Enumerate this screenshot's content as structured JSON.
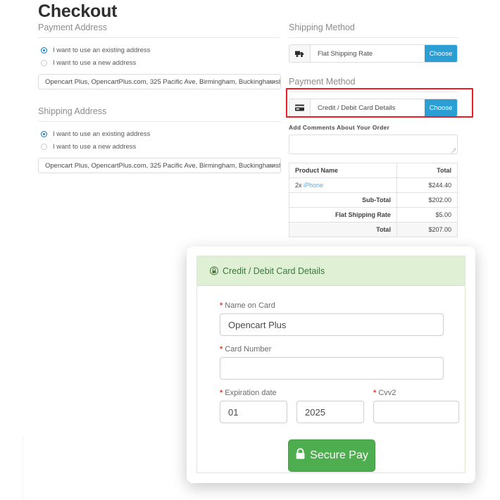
{
  "page": {
    "title": "Checkout"
  },
  "payment_address": {
    "legend": "Payment Address",
    "options": [
      {
        "label": "I want to use an existing address",
        "selected": true
      },
      {
        "label": "I want to use a new address",
        "selected": false
      }
    ],
    "select_value": "Opencart Plus, OpencartPlus.com, 325 Pacific Ave, Birmingham, Buckinghamshir"
  },
  "shipping_address": {
    "legend": "Shipping Address",
    "options": [
      {
        "label": "I want to use an existing address",
        "selected": true
      },
      {
        "label": "I want to use a new address",
        "selected": false
      }
    ],
    "select_value": "Opencart Plus, OpencartPlus.com, 325 Pacific Ave, Birmingham, Buckinghamshir"
  },
  "shipping_method": {
    "legend": "Shipping Method",
    "icon": "truck-icon",
    "name": "Flat Shipping Rate",
    "button_label": "Choose"
  },
  "payment_method": {
    "legend": "Payment Method",
    "icon": "credit-card-icon",
    "name": "Credit / Debit Card Details",
    "button_label": "Choose",
    "highlight_color": "#ee1d23"
  },
  "comments": {
    "label": "Add Comments About Your Order",
    "value": ""
  },
  "order_table": {
    "headers": [
      "Product Name",
      "Total"
    ],
    "rows": [
      {
        "qty": "2x",
        "product": "iPhone",
        "total": "$244.40"
      }
    ],
    "totals": [
      {
        "label": "Sub-Total",
        "value": "$202.00"
      },
      {
        "label": "Flat Shipping Rate",
        "value": "$5.00"
      },
      {
        "label": "Total",
        "value": "$207.00"
      }
    ]
  },
  "modal": {
    "header_icon": "lock-icon",
    "header_title": "Credit / Debit Card Details",
    "fields": {
      "name_label": "Name on Card",
      "name_value": "Opencart Plus",
      "card_label": "Card Number",
      "card_value": "",
      "exp_label": "Expiration date",
      "exp_month": "01",
      "exp_year": "2025",
      "cvv_label": "Cvv2",
      "cvv_value": ""
    },
    "submit_label": "Secure Pay",
    "required_mark": "*",
    "accent_green": "#4eae4f",
    "header_bg": "#dff0d5"
  },
  "colors": {
    "button_blue": "#2b9fd4",
    "link_blue": "#5aa9dd",
    "radio_blue": "#1b7fc4"
  }
}
